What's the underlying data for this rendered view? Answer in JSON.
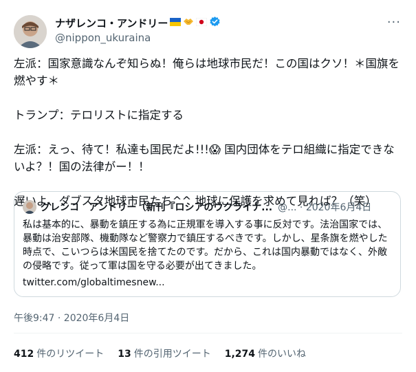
{
  "author": {
    "name": "ナザレンコ・アンドリー",
    "handle": "@nippon_ukuraina",
    "badges": [
      "ukraine-flag-icon",
      "handshake-icon",
      "japan-flag-icon",
      "verified-badge-icon"
    ]
  },
  "more_label": "···",
  "tweet": {
    "text": "左派：国家意識なんぞ知らぬ！俺らは地球市民だ！この国はクソ！＊国旗を燃やす＊\n\nトランプ：テロリストに指定する\n\n左派：えっ、待て！私達も国民だよ!!!😱 国内団体をテロ組織に指定できないよ？！国の法律がー！！\n\n遅いよ、ダブスタ地球市民たち^^ 地球に保護を求めて見れば？（笑）"
  },
  "quote": {
    "name": "グレンコ　アンドリー（新刊『ロシアのウクライナ...",
    "meta": "@... · 2020年6月4日",
    "text": "私は基本的に、暴動を鎮圧する為に正規軍を導入する事に反対です。法治国家では、暴動は治安部隊、機動隊など警察力で鎮圧するべきです。しかし、星条旗を燃やした時点で、こいつらは米国民を捨てたのです。だから、これは国内暴動ではなく、外敵の侵略です。従って軍は国を守る必要が出てきました。",
    "link": "twitter.com/globaltimesnew..."
  },
  "timestamp": "午後9:47 · 2020年6月4日",
  "stats": {
    "retweets_count": "412",
    "retweets_label": "件のリツイート",
    "quotes_count": "13",
    "quotes_label": "件の引用ツイート",
    "likes_count": "1,274",
    "likes_label": "件のいいね"
  },
  "colors": {
    "text": "#0f1419",
    "muted": "#536471",
    "border": "#cfd9de",
    "verified": "#1d9bf0"
  }
}
